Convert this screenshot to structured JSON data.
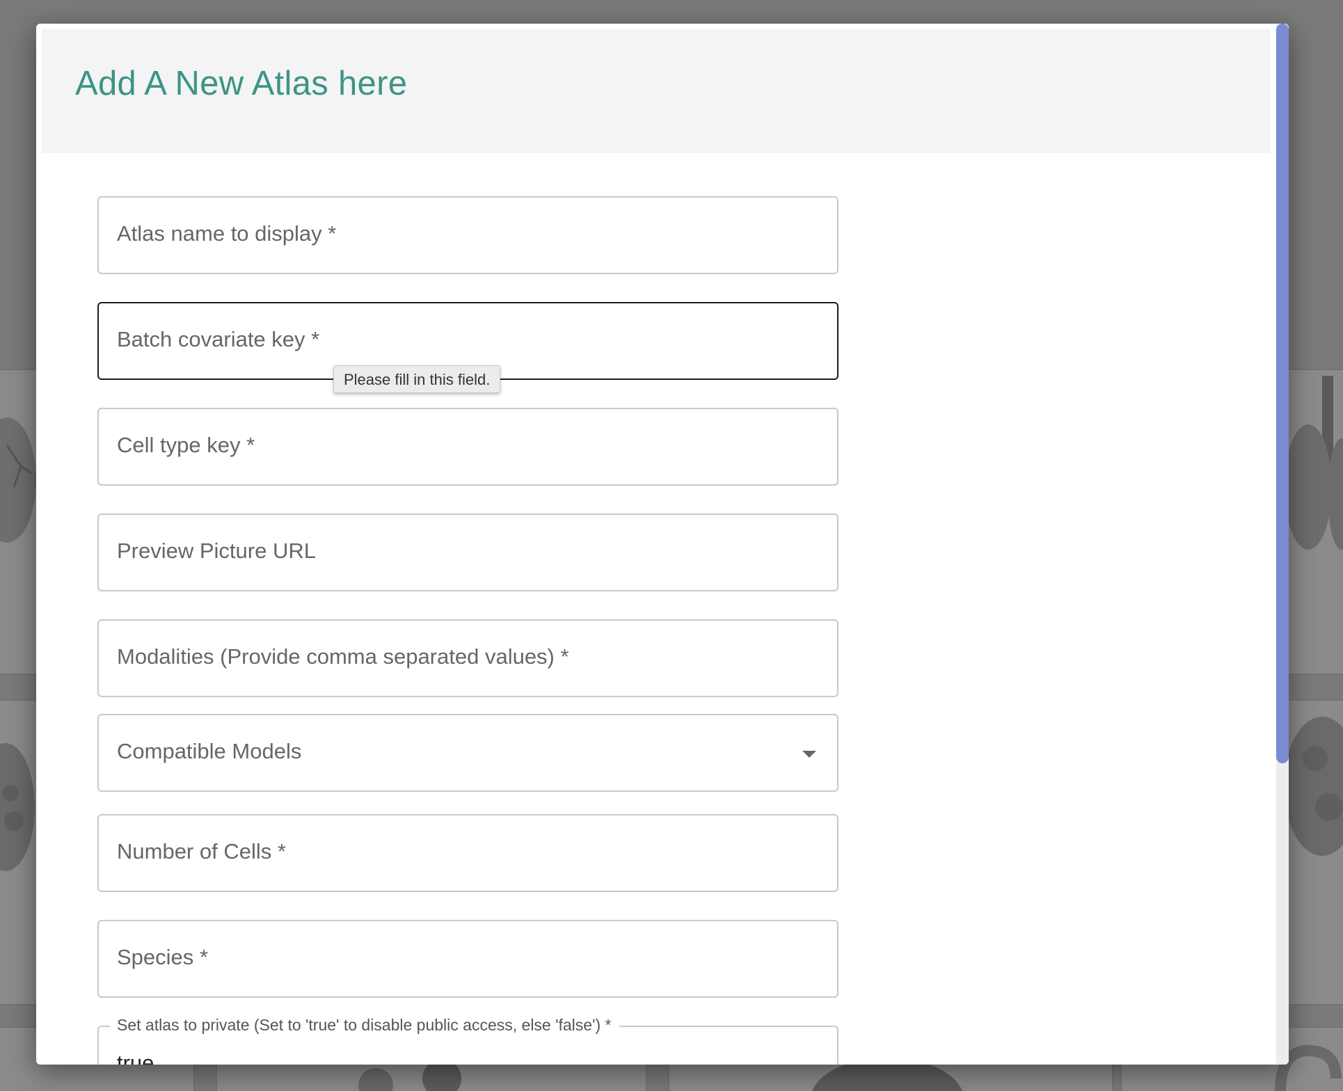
{
  "modal": {
    "title": "Add A New Atlas here"
  },
  "form": {
    "atlas_name": {
      "label": "Atlas name to display *"
    },
    "batch_key": {
      "label": "Batch covariate key *"
    },
    "cell_type_key": {
      "label": "Cell type key *"
    },
    "preview_url": {
      "label": "Preview Picture URL"
    },
    "modalities": {
      "label": "Modalities (Provide comma separated values) *"
    },
    "compatible_models": {
      "label": "Compatible Models"
    },
    "number_of_cells": {
      "label": "Number of Cells *"
    },
    "species": {
      "label": "Species *"
    },
    "private": {
      "label": "Set atlas to private (Set to 'true' to disable public access, else 'false') *",
      "value": "true"
    }
  },
  "tooltip": {
    "message": "Please fill in this field."
  },
  "colors": {
    "title": "#3c9486",
    "scrollbar_thumb": "#7a8bd3",
    "backdrop": "#7a7a7a",
    "focused_border": "#1d1d1d"
  },
  "icons": {
    "dropdown": "chevron-down-icon"
  }
}
